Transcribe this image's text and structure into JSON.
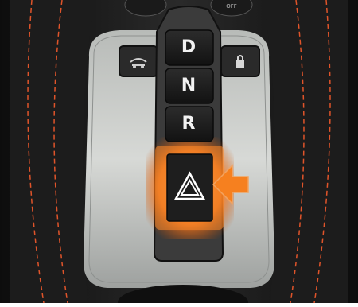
{
  "selector": {
    "gears": [
      {
        "id": "drive",
        "label": "D"
      },
      {
        "id": "neutral",
        "label": "N"
      },
      {
        "id": "reverse",
        "label": "R"
      }
    ],
    "hazard_icon": "hazard-warning-triangle-icon",
    "callout_icon": "orange-arrow-icon"
  },
  "controls": {
    "left_icon": "suspension-icon",
    "right_icon": "lock-icon"
  },
  "colors": {
    "highlight": "#ff7a1a",
    "arrow": "#f6801f",
    "stitching": "#e0542a"
  }
}
